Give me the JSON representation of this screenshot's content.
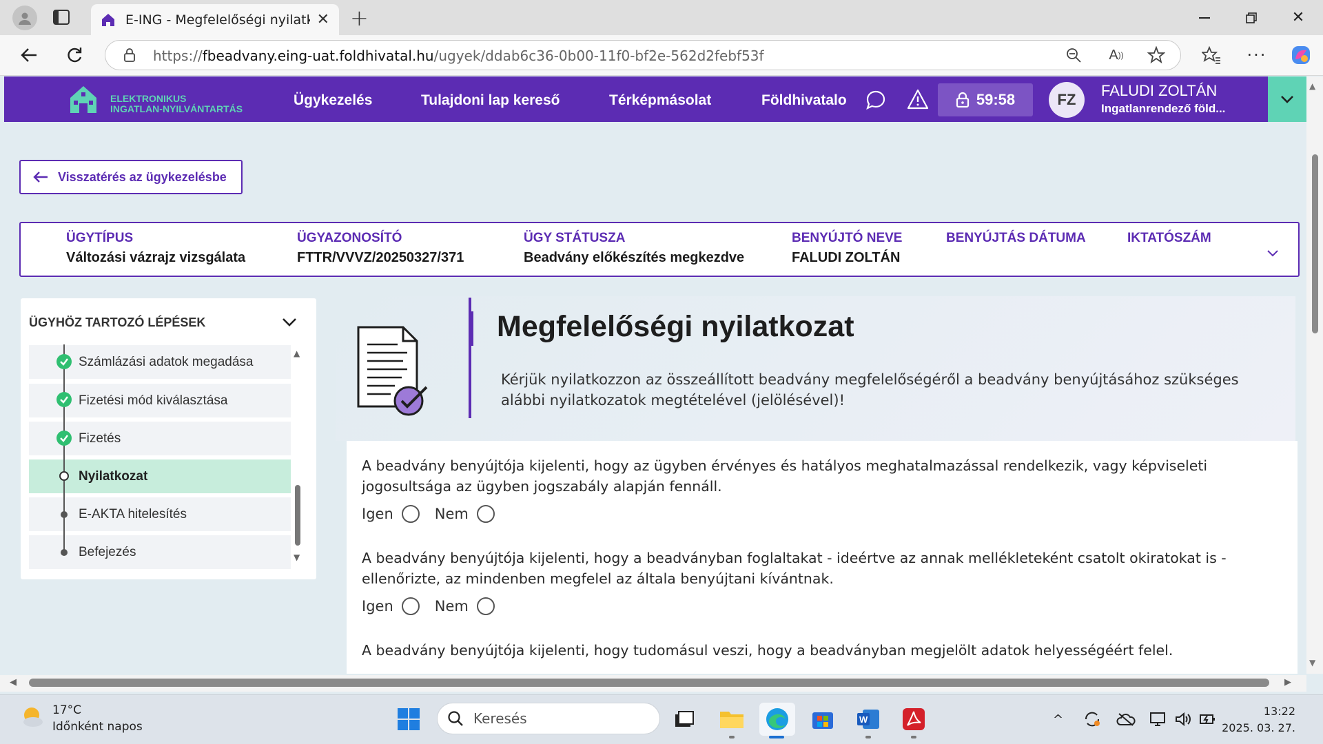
{
  "browser": {
    "tab_title": "E-ING - Megfelelőségi nyilatkozat",
    "url_scheme": "https://",
    "url_host": "fbeadvany.eing-uat.foldhivatal.hu",
    "url_path": "/ugyek/ddab6c36-0b00-11f0-bf2e-562d2febf53f"
  },
  "header": {
    "brand_line1": "ELEKTRONIKUS",
    "brand_line2": "INGATLAN-NYILVÁNTARTÁS",
    "nav": [
      "Ügykezelés",
      "Tulajdoni lap kereső",
      "Térképmásolat",
      "Földhivatalo"
    ],
    "timer": "59:58",
    "avatar_initials": "FZ",
    "user_name": "FALUDI ZOLTÁN",
    "user_role": "Ingatlanrendező föld..."
  },
  "back_button": "Visszatérés az ügykezelésbe",
  "case_info": [
    {
      "label": "ÜGYTÍPUS",
      "value": "Változási vázrajz vizsgálata"
    },
    {
      "label": "ÜGYAZONOSÍTÓ",
      "value": "FTTR/VVVZ/20250327/371"
    },
    {
      "label": "ÜGY STÁTUSZA",
      "value": "Beadvány előkészítés megkezdve"
    },
    {
      "label": "BENYÚJTÓ NEVE",
      "value": "FALUDI ZOLTÁN"
    },
    {
      "label": "BENYÚJTÁS DÁTUMA",
      "value": ""
    },
    {
      "label": "IKTATÓSZÁM",
      "value": ""
    }
  ],
  "steps": {
    "title": "ÜGYHÖZ TARTOZÓ LÉPÉSEK",
    "items": [
      {
        "label": "Számlázási adatok megadása",
        "status": "done"
      },
      {
        "label": "Fizetési mód kiválasztása",
        "status": "done"
      },
      {
        "label": "Fizetés",
        "status": "done"
      },
      {
        "label": "Nyilatkozat",
        "status": "current"
      },
      {
        "label": "E-AKTA hitelesítés",
        "status": "pending"
      },
      {
        "label": "Befejezés",
        "status": "pending"
      }
    ]
  },
  "main": {
    "title": "Megfelelőségi nyilatkozat",
    "description": "Kérjük nyilatkozzon az összeállított beadvány megfelelőségéről a beadvány benyújtásához szükséges alábbi nyilatkozatok megtételével (jelölésével)!",
    "yes_label": "Igen",
    "no_label": "Nem",
    "questions": [
      "A beadvány benyújtója kijelenti, hogy az ügyben érvényes és hatályos meghatalmazással rendelkezik, vagy képviseleti jogosultsága az ügyben jogszabály alapján fennáll.",
      "A beadvány benyújtója kijelenti, hogy a beadványban foglaltakat - ideértve az annak mellékleteként csatolt okiratokat is - ellenőrizte, az mindenben megfelel az általa benyújtani kívántnak.",
      "A beadvány benyújtója kijelenti, hogy tudomásul veszi, hogy a beadványban megjelölt adatok helyességéért felel."
    ]
  },
  "taskbar": {
    "search_placeholder": "Keresés",
    "weather_temp": "17°C",
    "weather_desc": "Időnként napos",
    "time": "13:22",
    "date": "2025. 03. 27."
  },
  "colors": {
    "brand_purple": "#5c2cb3",
    "brand_green": "#5fd3b5",
    "done_green": "#2fbf71",
    "active_step_bg": "#c7eddc"
  }
}
